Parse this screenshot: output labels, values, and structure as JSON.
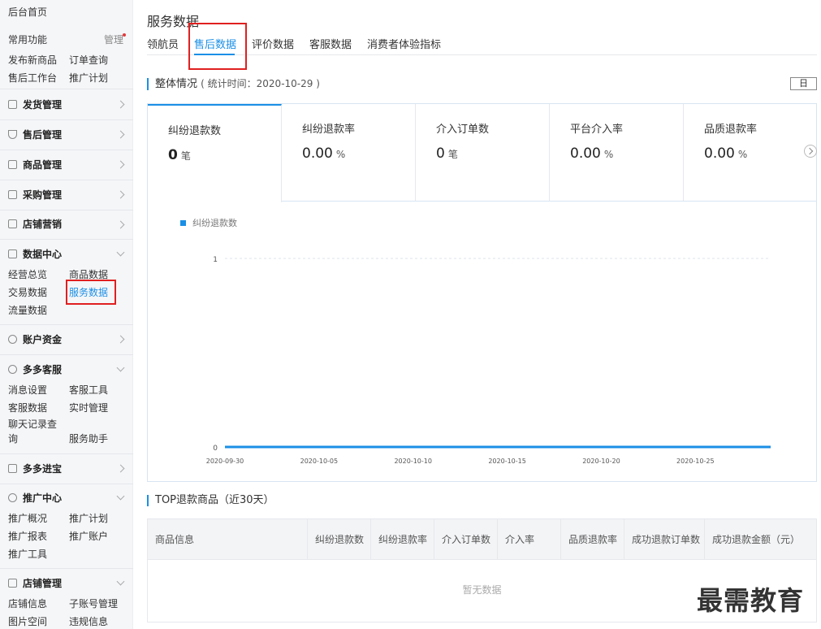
{
  "sidebar": {
    "home": "后台首页",
    "common": {
      "title": "常用功能",
      "manage": "管理",
      "links": [
        "发布新商品",
        "订单查询",
        "售后工作台",
        "推广计划"
      ]
    },
    "groups": [
      {
        "title": "发货管理",
        "icon": "document-icon",
        "expanded": false
      },
      {
        "title": "售后管理",
        "icon": "shield-icon",
        "expanded": false
      },
      {
        "title": "商品管理",
        "icon": "bag-icon",
        "expanded": false
      },
      {
        "title": "采购管理",
        "icon": "list-icon",
        "expanded": false
      },
      {
        "title": "店铺营销",
        "icon": "calendar-icon",
        "expanded": false
      },
      {
        "title": "数据中心",
        "icon": "bar-chart-icon",
        "expanded": true,
        "links": [
          "经营总览",
          "商品数据",
          "交易数据",
          "服务数据",
          "流量数据"
        ]
      },
      {
        "title": "账户资金",
        "icon": "coin-icon",
        "expanded": false
      },
      {
        "title": "多多客服",
        "icon": "headset-icon",
        "expanded": true,
        "links": [
          "消息设置",
          "客服工具",
          "客服数据",
          "实时管理",
          "聊天记录查询",
          "服务助手"
        ]
      },
      {
        "title": "多多进宝",
        "icon": "gift-icon",
        "expanded": false
      },
      {
        "title": "推广中心",
        "icon": "share-icon",
        "expanded": true,
        "links": [
          "推广概况",
          "推广计划",
          "推广报表",
          "推广账户",
          "推广工具"
        ]
      },
      {
        "title": "店铺管理",
        "icon": "store-icon",
        "expanded": true,
        "links": [
          "店铺信息",
          "子账号管理",
          "图片空间",
          "违规信息"
        ]
      }
    ]
  },
  "main": {
    "title": "服务数据",
    "tabs": [
      "领航员",
      "售后数据",
      "评价数据",
      "客服数据",
      "消费者体验指标"
    ],
    "active_tab": "售后数据",
    "overview": {
      "title": "整体情况",
      "subtitle": "( 统计时间：2020-10-29 )",
      "period_button": "日"
    },
    "cards": [
      {
        "label": "纠纷退款数",
        "value": "0",
        "unit": "笔"
      },
      {
        "label": "纠纷退款率",
        "value": "0.00",
        "unit": "%"
      },
      {
        "label": "介入订单数",
        "value": "0",
        "unit": "笔"
      },
      {
        "label": "平台介入率",
        "value": "0.00",
        "unit": "%"
      },
      {
        "label": "品质退款率",
        "value": "0.00",
        "unit": "%"
      }
    ],
    "top": {
      "title": "TOP退款商品（近30天）",
      "columns": [
        "商品信息",
        "纠纷退款数",
        "纠纷退款率",
        "介入订单数",
        "介入率",
        "品质退款率",
        "成功退款订单数",
        "成功退款金额（元）"
      ],
      "empty": "暂无数据"
    },
    "watermark": "最需教育"
  },
  "chart_data": {
    "type": "line",
    "x": [
      "2020-09-30",
      "2020-10-01",
      "2020-10-02",
      "2020-10-03",
      "2020-10-04",
      "2020-10-05",
      "2020-10-06",
      "2020-10-07",
      "2020-10-08",
      "2020-10-09",
      "2020-10-10",
      "2020-10-11",
      "2020-10-12",
      "2020-10-13",
      "2020-10-14",
      "2020-10-15",
      "2020-10-16",
      "2020-10-17",
      "2020-10-18",
      "2020-10-19",
      "2020-10-20",
      "2020-10-21",
      "2020-10-22",
      "2020-10-23",
      "2020-10-24",
      "2020-10-25",
      "2020-10-26",
      "2020-10-27",
      "2020-10-28",
      "2020-10-29"
    ],
    "xticks": [
      "2020-09-30",
      "2020-10-05",
      "2020-10-10",
      "2020-10-15",
      "2020-10-20",
      "2020-10-25"
    ],
    "yticks": [
      "1",
      "0"
    ],
    "ylim": [
      0,
      1
    ],
    "series": [
      {
        "name": "纠纷退款数",
        "color": "#1b8fe6",
        "values": [
          0,
          0,
          0,
          0,
          0,
          0,
          0,
          0,
          0,
          0,
          0,
          0,
          0,
          0,
          0,
          0,
          0,
          0,
          0,
          0,
          0,
          0,
          0,
          0,
          0,
          0,
          0,
          0,
          0,
          0
        ]
      }
    ],
    "grid": "dashed horizontal",
    "legend": "top-left"
  }
}
